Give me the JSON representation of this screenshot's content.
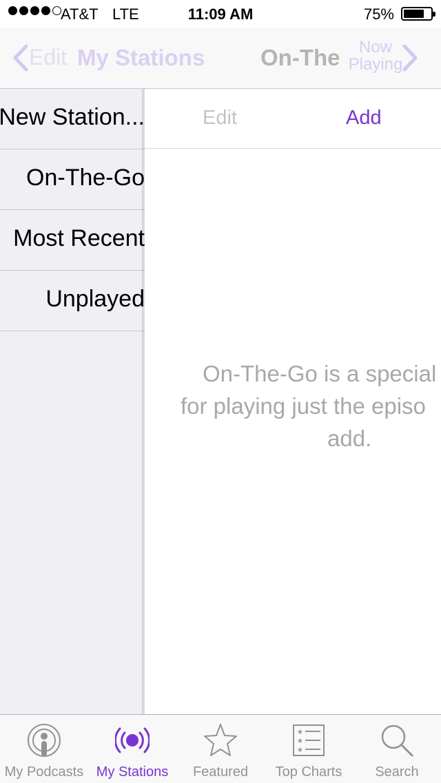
{
  "status_bar": {
    "carrier": "AT&T",
    "network": "LTE",
    "time": "11:09 AM",
    "battery_percent": "75%",
    "battery_level": 0.75,
    "signal_bars": 4
  },
  "nav": {
    "back_label": "Edit",
    "title": "My Stations",
    "current_title": "On-The",
    "now_playing_line1": "Now",
    "now_playing_line2": "Playing"
  },
  "sidebar": {
    "items": [
      {
        "label": "New Station..."
      },
      {
        "label": "On-The-Go"
      },
      {
        "label": "Most Recent"
      },
      {
        "label": "Unplayed"
      }
    ]
  },
  "detail": {
    "edit_label": "Edit",
    "add_label": "Add",
    "message_lines": [
      "On-The-Go is a special",
      "for playing just the episo",
      "add."
    ]
  },
  "tabs": [
    {
      "label": "My Podcasts",
      "icon": "podcast-icon",
      "active": false
    },
    {
      "label": "My Stations",
      "icon": "station-icon",
      "active": true
    },
    {
      "label": "Featured",
      "icon": "star-icon",
      "active": false
    },
    {
      "label": "Top Charts",
      "icon": "list-icon",
      "active": false
    },
    {
      "label": "Search",
      "icon": "search-icon",
      "active": false
    }
  ],
  "colors": {
    "accent": "#7a33d1",
    "inactive": "#929292"
  }
}
